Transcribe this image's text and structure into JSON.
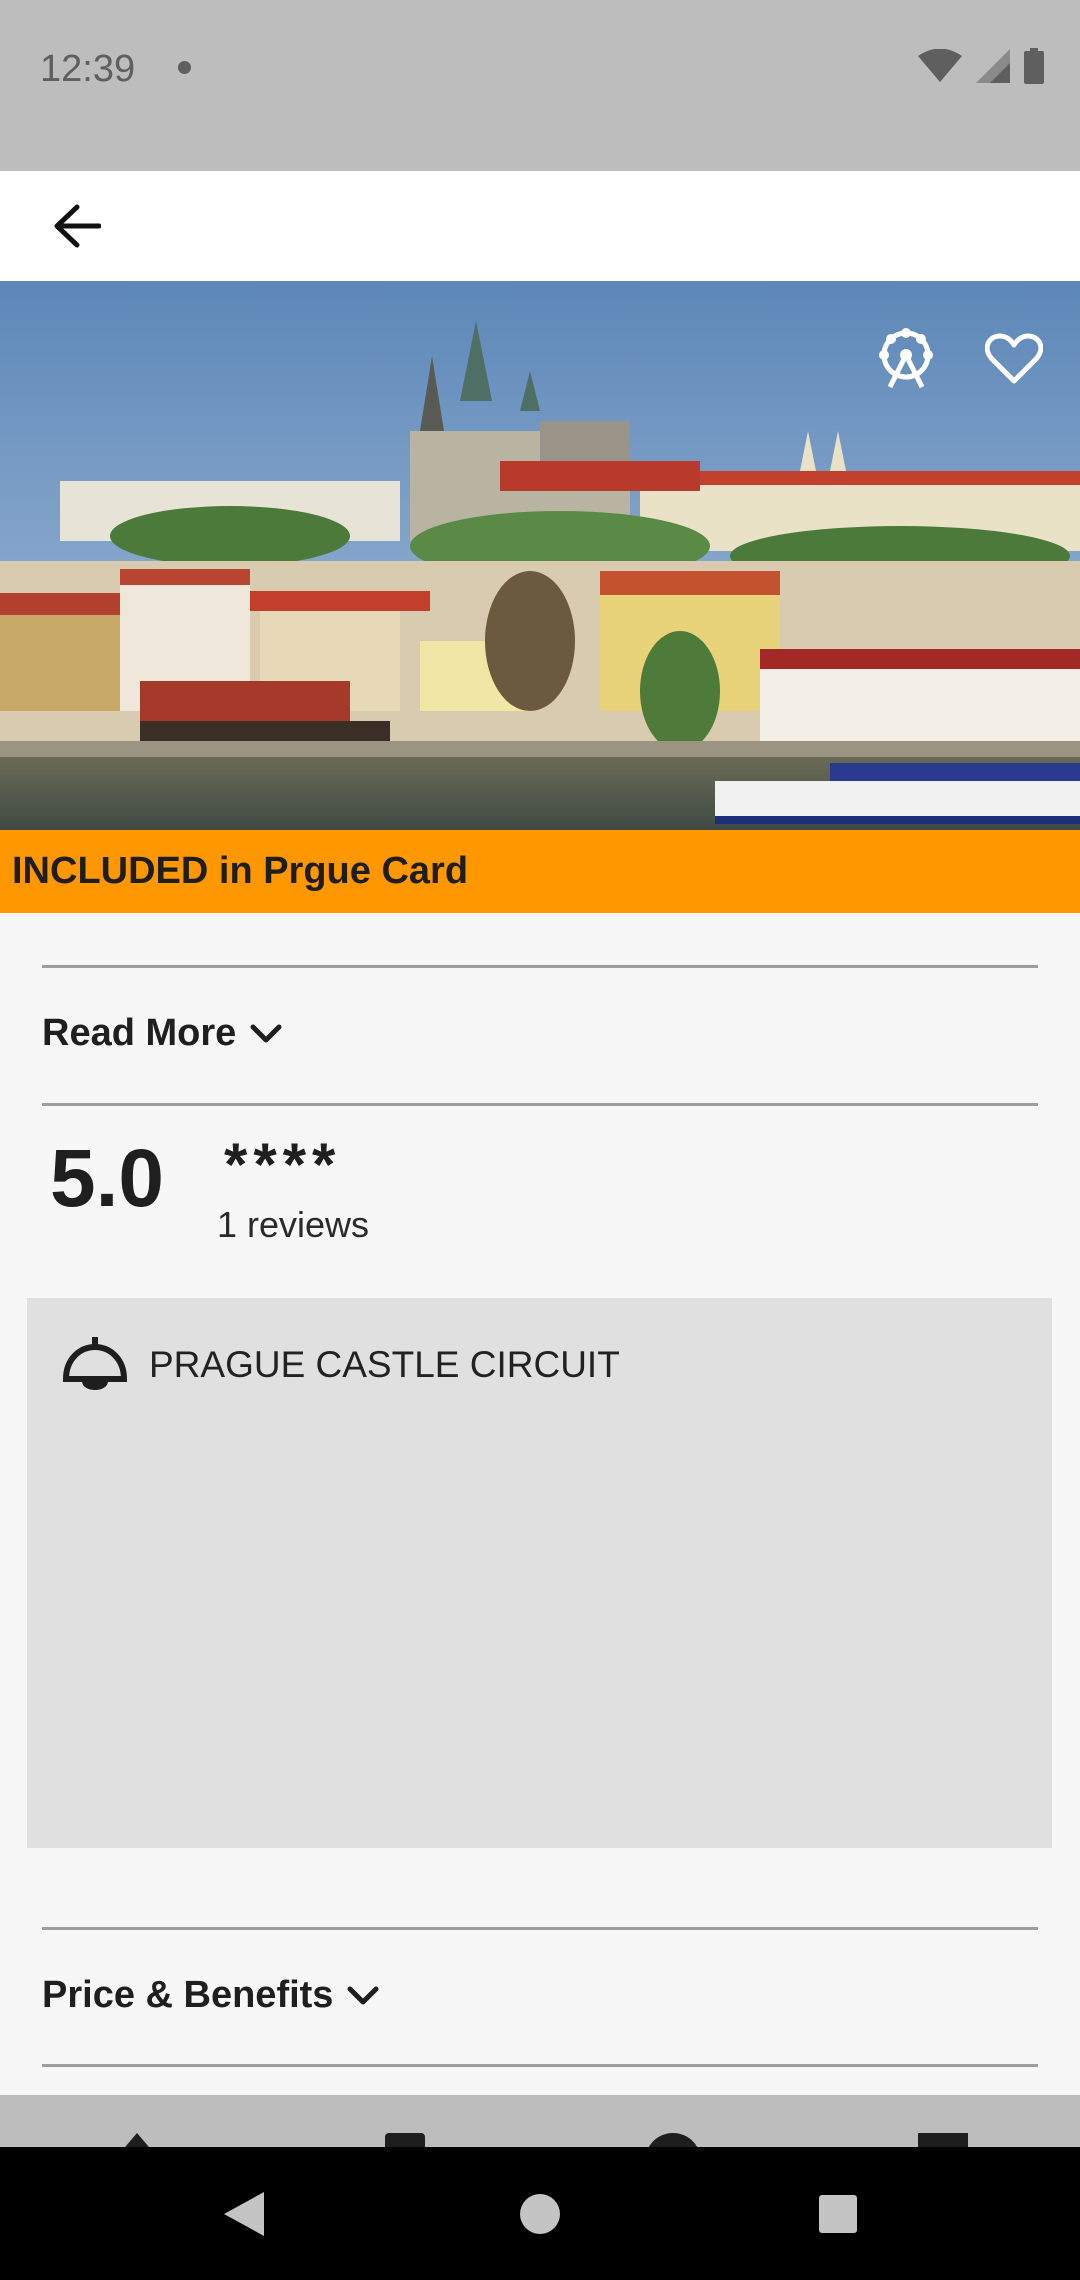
{
  "status_bar": {
    "time": "12:39",
    "icons": [
      "notification-dot",
      "wifi-icon",
      "signal-icon",
      "battery-icon"
    ]
  },
  "top_bar": {
    "back_icon": "arrow-left-icon"
  },
  "hero": {
    "icons": [
      "attraction-icon",
      "heart-outline-icon"
    ]
  },
  "banner": {
    "text": "INCLUDED in Prgue Card",
    "color": "#ff9800"
  },
  "read_more": {
    "label": "Read More",
    "icon": "chevron-down-icon"
  },
  "rating": {
    "score": "5.0",
    "stars": "****",
    "reviews": "1 reviews"
  },
  "tour": {
    "title": "PRAGUE CASTLE CIRCUIT",
    "icon": "lamp-icon"
  },
  "price_benefits": {
    "label": "Price & Benefits",
    "icon": "chevron-down-icon"
  },
  "system_nav": {
    "buttons": [
      "back-triangle",
      "home-circle",
      "recents-square"
    ]
  }
}
